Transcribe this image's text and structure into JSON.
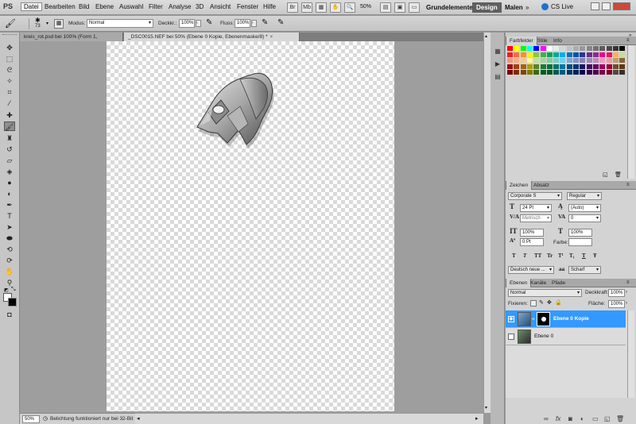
{
  "app": {
    "logo": "PS"
  },
  "menu": [
    "Datei",
    "Bearbeiten",
    "Bild",
    "Ebene",
    "Auswahl",
    "Filter",
    "Analyse",
    "3D",
    "Ansicht",
    "Fenster",
    "Hilfe"
  ],
  "menu_active_index": 0,
  "menubar": {
    "zoom": "50%",
    "workspaces": [
      "Grundelemente",
      "Design",
      "Malen"
    ],
    "active_workspace": "Design",
    "cs_live": "CS Live"
  },
  "options": {
    "brush_size": "73",
    "mode_label": "Modus:",
    "mode_value": "Normal",
    "opacity_label": "Deckkr.:",
    "opacity_value": "100%",
    "flow_label": "Fluss:",
    "flow_value": "100%"
  },
  "tabs": [
    {
      "label": "kreis_rot.psd bei 100% (Form 1, RGB/8)",
      "close": "×"
    },
    {
      "label": "_DSC0015.NEF bei 50% (Ebene 0 Kopie, Ebenenmaske/8) *",
      "close": "×"
    }
  ],
  "active_tab": 1,
  "status": {
    "zoom": "50%",
    "message": "Belichtung funktioniert nur bei 32-Bit"
  },
  "swatches_panel": {
    "tabs": [
      "Farbfelder",
      "Stile",
      "Info"
    ]
  },
  "swatch_colors": [
    [
      "#ff0000",
      "#ffff00",
      "#00ff00",
      "#00ffff",
      "#0000ff",
      "#ff00ff",
      "#ffffff",
      "#ebebeb",
      "#d6d6d6",
      "#c2c2c2",
      "#adadad",
      "#999999",
      "#858585",
      "#707070",
      "#5c5c5c",
      "#474747",
      "#333333",
      "#000000"
    ],
    [
      "#ee1d24",
      "#f26c4f",
      "#f7941d",
      "#fff200",
      "#8dc63f",
      "#39b54a",
      "#00a651",
      "#00a99d",
      "#00aeef",
      "#0072bc",
      "#0054a6",
      "#2e3192",
      "#662d91",
      "#92278f",
      "#ec008c",
      "#ed145b",
      "#fbaf5d",
      "#c4df9b"
    ],
    [
      "#f69679",
      "#f9ad81",
      "#fdc68a",
      "#fff799",
      "#c4df9b",
      "#a3d39c",
      "#82ca9c",
      "#7accc8",
      "#6dcff6",
      "#7da7d9",
      "#8393ca",
      "#8781bd",
      "#a186be",
      "#bd8cbf",
      "#f49ac1",
      "#f5989d",
      "#c69c6d",
      "#8c6239"
    ],
    [
      "#9e0b0f",
      "#a0410d",
      "#a36209",
      "#aba000",
      "#598527",
      "#1a7b30",
      "#007236",
      "#00746b",
      "#0076a3",
      "#004b80",
      "#003471",
      "#1b1464",
      "#440e62",
      "#630460",
      "#9e005d",
      "#9e0039",
      "#754c24",
      "#603913"
    ],
    [
      "#790000",
      "#7b2e00",
      "#7d4900",
      "#827b00",
      "#406618",
      "#005e20",
      "#005826",
      "#005952",
      "#005b7f",
      "#003663",
      "#002157",
      "#0d004c",
      "#32004b",
      "#4b0049",
      "#7b0046",
      "#7a0026",
      "#534741",
      "#362f2d"
    ]
  ],
  "character_panel": {
    "tabs": [
      "Zeichen",
      "Absatz"
    ],
    "font_family": "Corporate S",
    "font_style": "Regular",
    "size": "24 Pt",
    "leading": "(Auto)",
    "kerning": "Metrisch",
    "tracking": "0",
    "vscale": "100%",
    "hscale": "100%",
    "baseline": "0 Pt",
    "color_label": "Farbe:",
    "type_buttons": [
      "T",
      "T",
      "TT",
      "Tr",
      "T¹",
      "T₁",
      "T",
      "Ŧ"
    ],
    "language": "Deutsch neue ...",
    "aa_label": "aa",
    "antialias": "Scharf"
  },
  "layers_panel": {
    "tabs": [
      "Ebenen",
      "Kanäle",
      "Pfade"
    ],
    "blend_mode": "Normal",
    "opacity_label": "Deckkraft:",
    "opacity": "100%",
    "lock_label": "Fixieren:",
    "fill_label": "Fläche:",
    "fill": "100%",
    "layers": [
      {
        "name": "Ebene 0 Kopie",
        "visible": true,
        "active": true
      },
      {
        "name": "Ebene 0",
        "visible": false,
        "active": false
      }
    ]
  },
  "colors": {
    "selection": "#3399ff",
    "menubar": "#d2d2d2",
    "workspace": "#9e9e9e"
  }
}
